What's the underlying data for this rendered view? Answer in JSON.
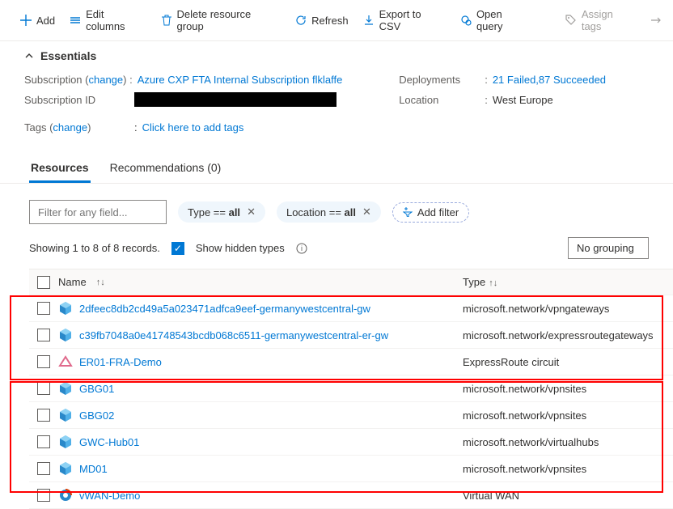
{
  "toolbar": {
    "add": "Add",
    "editColumns": "Edit columns",
    "delete": "Delete resource group",
    "refresh": "Refresh",
    "exportCsv": "Export to CSV",
    "openQuery": "Open query",
    "assignTags": "Assign tags"
  },
  "essentials": {
    "header": "Essentials",
    "subscriptionLabel": "Subscription (",
    "change": "change",
    "subscriptionParenEnd": ") :",
    "subscriptionName": "Azure CXP FTA Internal Subscription flklaffe",
    "subscriptionIdLabel": "Subscription ID",
    "deploymentsLabel": "Deployments",
    "deploymentsValue": "21 Failed,87 Succeeded",
    "locationLabel": "Location",
    "locationValue": "West Europe",
    "tagsLabel": "Tags (",
    "tagsParenEnd": ")",
    "tagsValue": "Click here to add tags",
    "colon": ":"
  },
  "tabs": {
    "resources": "Resources",
    "recommendations": "Recommendations (0)"
  },
  "filter": {
    "placeholder": "Filter for any field...",
    "chipTypePrefix": "Type == ",
    "chipTypeVal": "all",
    "chipLocPrefix": "Location == ",
    "chipLocVal": "all",
    "addFilter": "Add filter"
  },
  "records": {
    "text": "Showing 1 to 8 of 8 records.",
    "showHidden": "Show hidden types",
    "grouping": "No grouping"
  },
  "columns": {
    "name": "Name",
    "type": "Type"
  },
  "rows": [
    {
      "name": "2dfeec8db2cd49a5a023471adfca9eef-germanywestcentral-gw",
      "type": "microsoft.network/vpngateways",
      "iconType": "cube"
    },
    {
      "name": "c39fb7048a0e41748543bcdb068c6511-germanywestcentral-er-gw",
      "type": "microsoft.network/expressroutegateways",
      "iconType": "cube"
    },
    {
      "name": "ER01-FRA-Demo",
      "type": "ExpressRoute circuit",
      "iconType": "er"
    },
    {
      "name": "GBG01",
      "type": "microsoft.network/vpnsites",
      "iconType": "cube"
    },
    {
      "name": "GBG02",
      "type": "microsoft.network/vpnsites",
      "iconType": "cube"
    },
    {
      "name": "GWC-Hub01",
      "type": "microsoft.network/virtualhubs",
      "iconType": "cube"
    },
    {
      "name": "MD01",
      "type": "microsoft.network/vpnsites",
      "iconType": "cube"
    },
    {
      "name": "vWAN-Demo",
      "type": "Virtual WAN",
      "iconType": "vwan"
    }
  ]
}
